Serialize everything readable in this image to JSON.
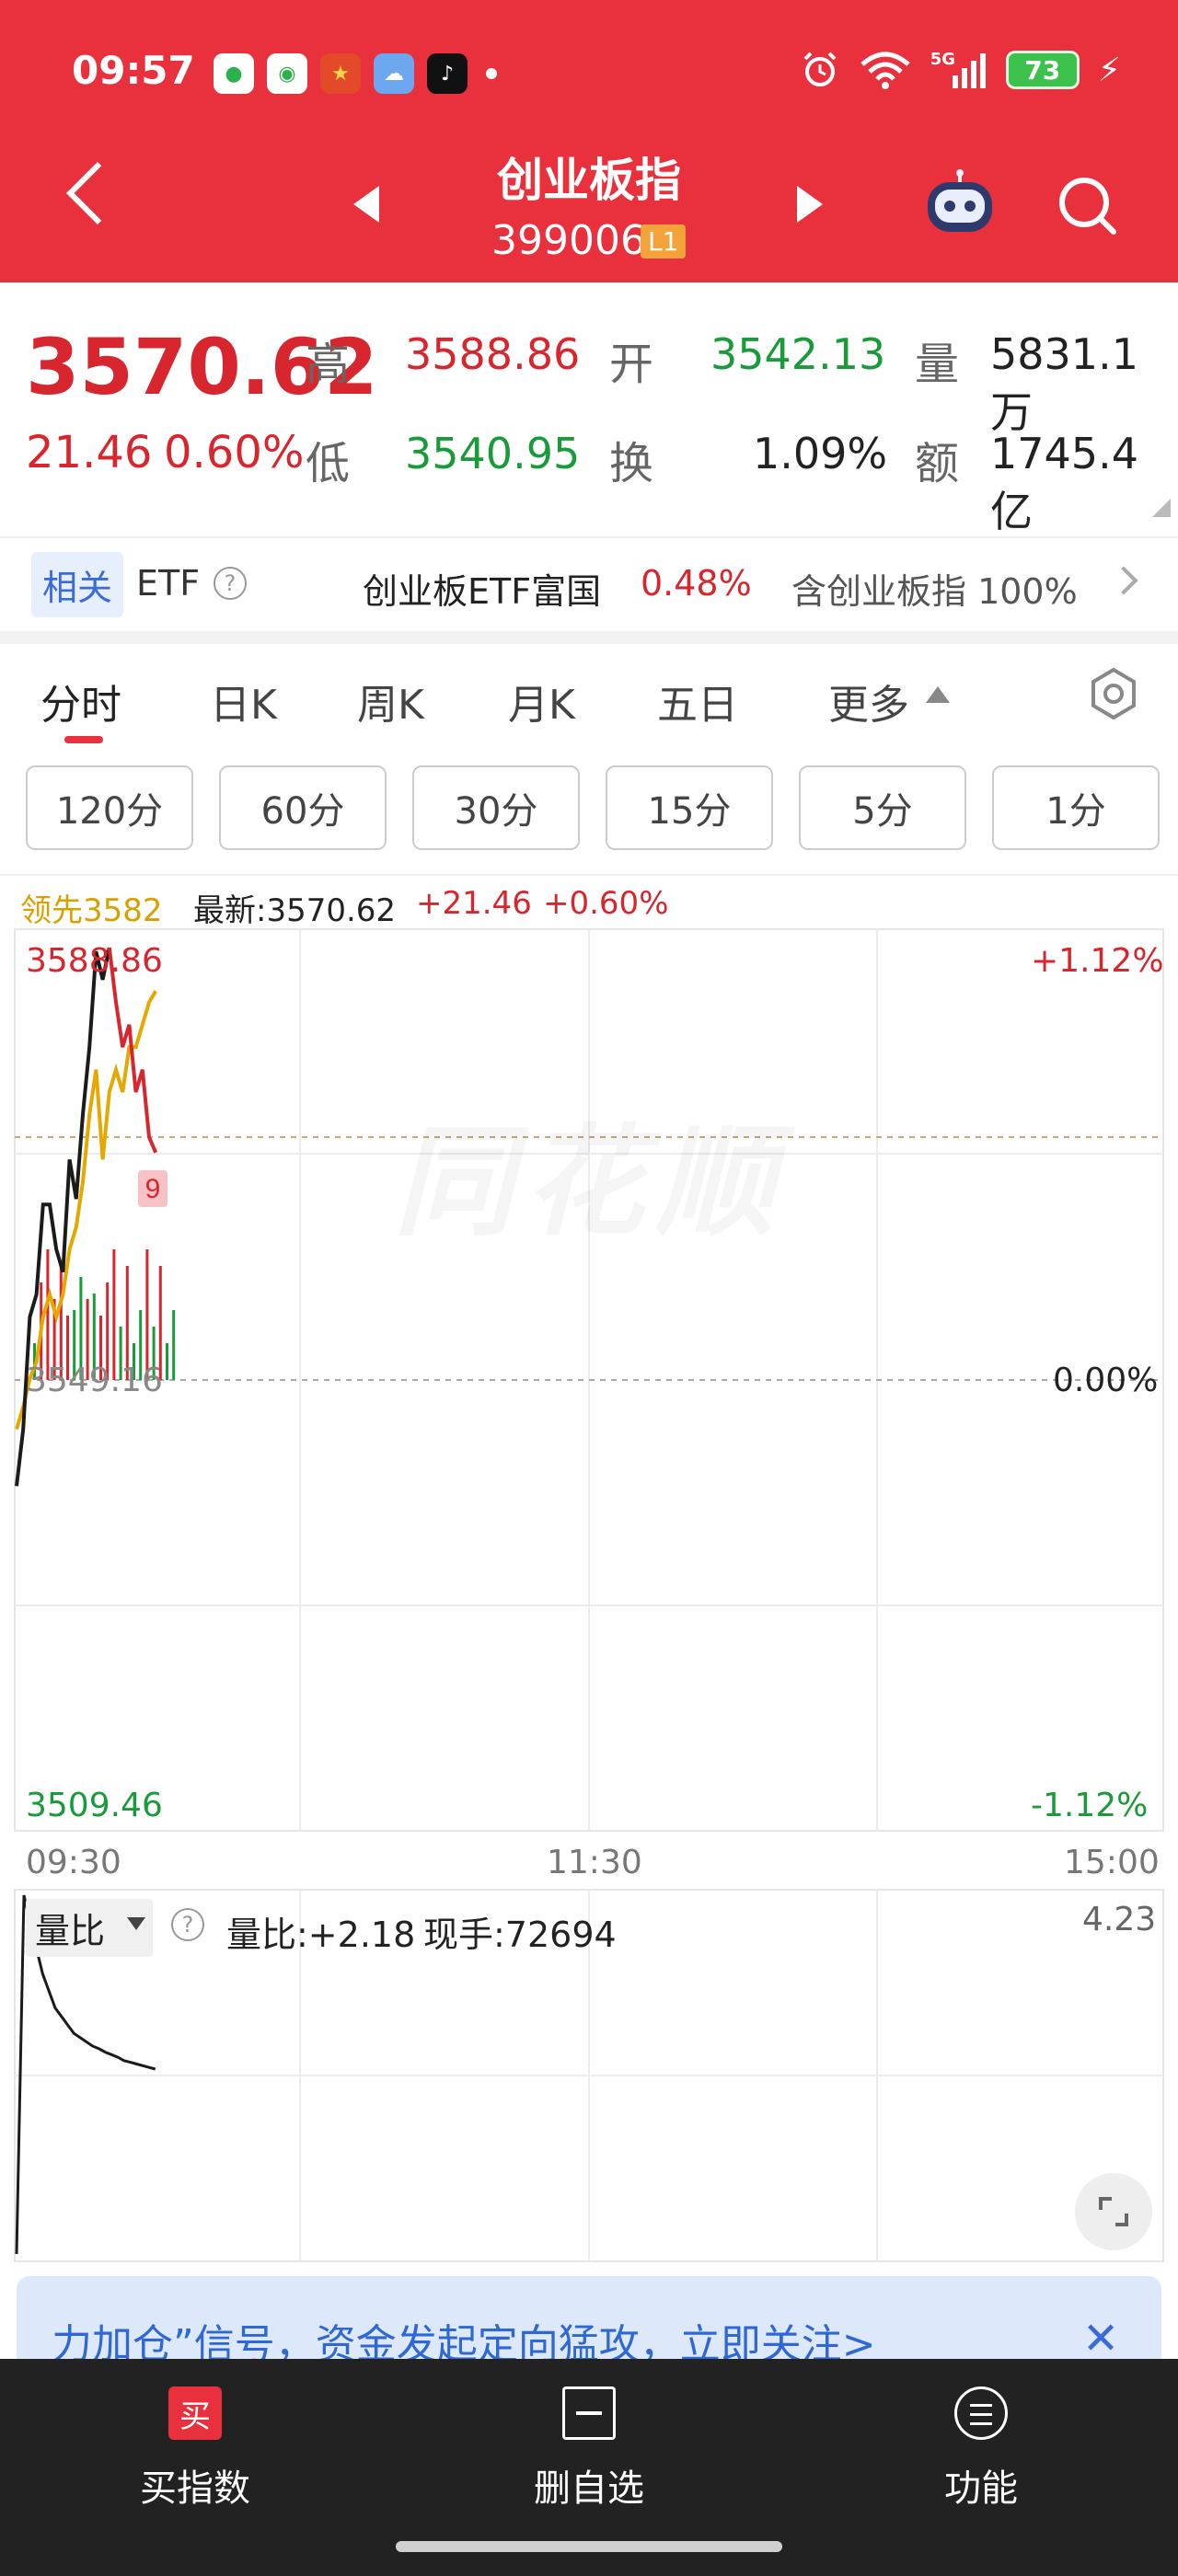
{
  "status_bar": {
    "time": "09:57",
    "battery": "73",
    "network": "5G",
    "app_icons": [
      "message-icon",
      "wechat-icon",
      "red-app-icon",
      "weather-icon",
      "tiktok-icon"
    ]
  },
  "header": {
    "title": "创业板指",
    "code": "399006",
    "level_badge": "L1"
  },
  "quote": {
    "price": "3570.62",
    "change": "21.46",
    "change_pct": "0.60%",
    "high_label": "高",
    "high": "3588.86",
    "open_label": "开",
    "open": "3542.13",
    "volume_label": "量",
    "volume": "5831.1万",
    "low_label": "低",
    "low": "3540.95",
    "turnover_label": "换",
    "turnover": "1.09%",
    "amount_label": "额",
    "amount": "1745.4亿"
  },
  "related_etf": {
    "tag": "相关",
    "label": "ETF",
    "name": "创业板ETF富国",
    "pct": "0.48%",
    "contains": "含创业板指 100%"
  },
  "tabs": [
    {
      "label": "分时",
      "active": true
    },
    {
      "label": "日K"
    },
    {
      "label": "周K"
    },
    {
      "label": "月K"
    },
    {
      "label": "五日"
    },
    {
      "label": "更多"
    }
  ],
  "periods": [
    "120分",
    "60分",
    "30分",
    "15分",
    "5分",
    "1分"
  ],
  "chart_info": {
    "lead": "领先3582",
    "latest": "最新:3570.62",
    "change": "+21.46",
    "pct": "+0.60%"
  },
  "chart": {
    "top_price": "3588.86",
    "mid_price": "3549.16",
    "bottom_price": "3509.46",
    "top_pct": "+1.12%",
    "mid_pct": "0.00%",
    "bottom_pct": "-1.12%",
    "marker": "9",
    "watermark": "同花顺",
    "times": [
      "09:30",
      "11:30",
      "15:00"
    ]
  },
  "volume_ratio": {
    "selector": "量比",
    "ratio": "量比:+2.18",
    "hand": "现手:72694",
    "max": "4.23"
  },
  "banner": {
    "text": "力加仓”信号，资金发起定向猛攻，立即关注>",
    "close": "✕"
  },
  "bottom_nav": [
    {
      "label": "买指数",
      "icon_text": "买"
    },
    {
      "label": "删自选"
    },
    {
      "label": "功能"
    }
  ],
  "colors": {
    "brand_red": "#e8313c",
    "up": "#d8262f",
    "down": "#1a9b3a",
    "avg_line": "#e6a700"
  },
  "chart_data": {
    "type": "line",
    "x_range": [
      "09:30",
      "15:00"
    ],
    "ylim": [
      3509.46,
      3588.86
    ],
    "prev_close": 3549.16,
    "series": [
      {
        "values": [
          3540.95,
          3546.0,
          3556.0,
          3558.0,
          3566.0,
          3566.0,
          3562.0,
          3560.0,
          3570.0,
          3566.5,
          3574.0,
          3580.0,
          3588.5,
          3586.0,
          3588.86,
          3584.0,
          3580.0,
          3582.0,
          3576.0,
          3578.0,
          3572.0,
          3570.62
        ]
      },
      {
        "values": [
          3546.0,
          3548.0,
          3550.5,
          3552.0,
          3556.0,
          3558.0,
          3556.0,
          3558.0,
          3562.0,
          3564.0,
          3568.0,
          3574.0,
          3578.0,
          3570.0,
          3576.0,
          3578.0,
          3576.0,
          3580.0,
          3580.0,
          3582.0,
          3584.0,
          3585.0
        ]
      }
    ],
    "volume_ratio_values": [
      4.23,
      3.9,
      3.6,
      3.3,
      3.1,
      2.9,
      2.8,
      2.7,
      2.6,
      2.55,
      2.5,
      2.45,
      2.42,
      2.38,
      2.35,
      2.32,
      2.28,
      2.26,
      2.24,
      2.22,
      2.2,
      2.18
    ]
  }
}
